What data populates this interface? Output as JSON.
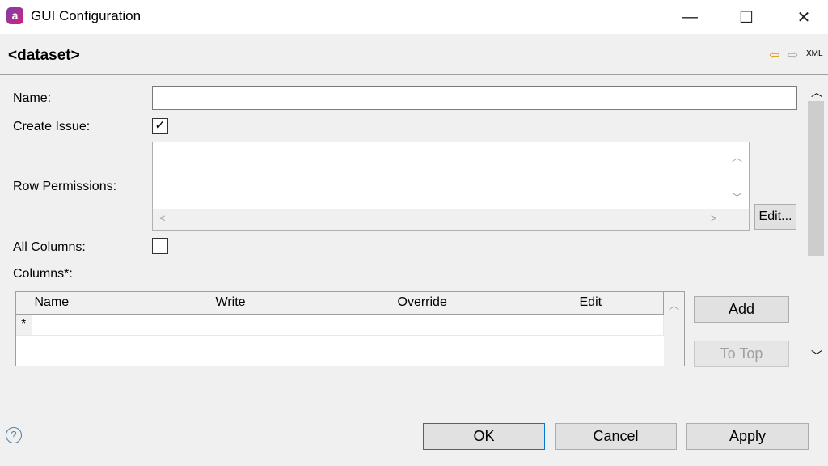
{
  "window": {
    "title": "GUI Configuration",
    "icon": "app-logo",
    "minimize": "—",
    "maximize": "☐",
    "close": "✕"
  },
  "header": {
    "title": "<dataset>",
    "back_icon": "arrow-left-icon",
    "forward_icon": "arrow-right-icon",
    "xml_label": "XML"
  },
  "form": {
    "name_label": "Name:",
    "name_value": "",
    "create_issue_label": "Create Issue:",
    "create_issue_checked": true,
    "row_permissions_label": "Row Permissions:",
    "row_permissions_value": "",
    "edit_label": "Edit...",
    "all_columns_label": "All Columns:",
    "all_columns_checked": false,
    "columns_label": "Columns*:"
  },
  "columns_table": {
    "headers": [
      "Name",
      "Write",
      "Override",
      "Edit"
    ],
    "new_row_marker": "*",
    "add_label": "Add",
    "to_top_label": "To Top"
  },
  "footer": {
    "help_icon": "?",
    "ok": "OK",
    "cancel": "Cancel",
    "apply": "Apply"
  }
}
